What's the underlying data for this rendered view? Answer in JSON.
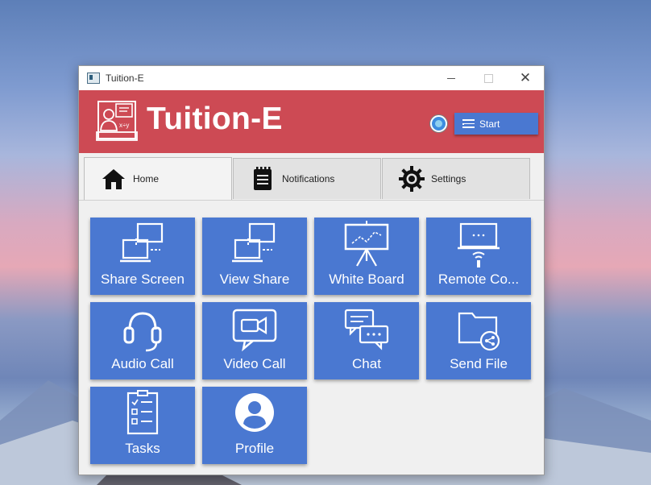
{
  "window": {
    "title": "Tuition-E",
    "controls": {
      "minimize": "minimize",
      "maximize": "maximize",
      "close": "✕"
    }
  },
  "header": {
    "brand": "Tuition-E",
    "start_label": "Start",
    "accent": "#cd4a54",
    "button_color": "#4a78d1"
  },
  "tabs": [
    {
      "label": "Home",
      "icon": "home-icon",
      "active": true
    },
    {
      "label": "Notifications",
      "icon": "notebook-icon",
      "active": false
    },
    {
      "label": "Settings",
      "icon": "gear-icon",
      "active": false
    }
  ],
  "tiles": [
    {
      "label": "Share Screen",
      "icon": "share-screen-icon"
    },
    {
      "label": "View Share",
      "icon": "view-share-icon"
    },
    {
      "label": "White Board",
      "icon": "whiteboard-icon"
    },
    {
      "label": "Remote Co...",
      "icon": "remote-control-icon"
    },
    {
      "label": "Audio Call",
      "icon": "headset-icon"
    },
    {
      "label": "Video Call",
      "icon": "video-call-icon"
    },
    {
      "label": "Chat",
      "icon": "chat-icon"
    },
    {
      "label": "Send File",
      "icon": "send-file-icon"
    },
    {
      "label": "Tasks",
      "icon": "tasks-icon"
    },
    {
      "label": "Profile",
      "icon": "profile-icon"
    }
  ]
}
